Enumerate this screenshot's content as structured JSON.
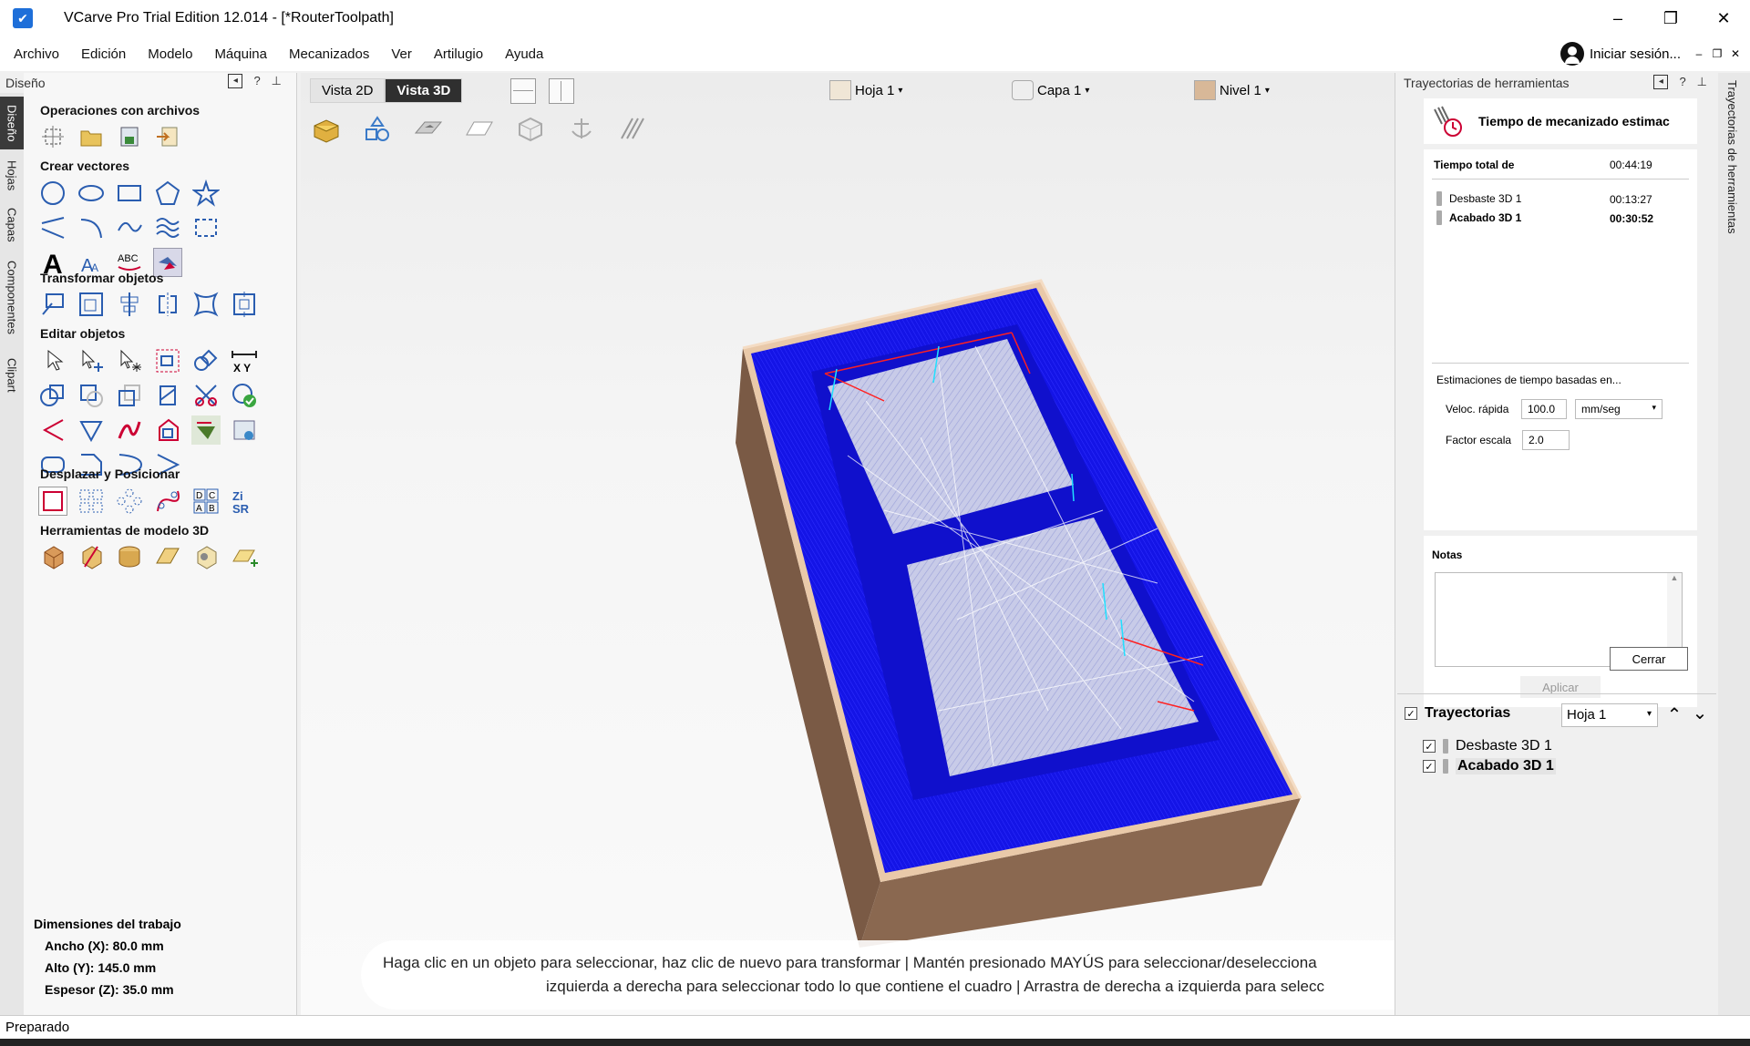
{
  "window": {
    "title": "VCarve Pro Trial Edition 12.014 - [*RouterToolpath]",
    "minimize": "–",
    "restore": "❐",
    "close": "✕"
  },
  "menu": [
    "Archivo",
    "Edición",
    "Modelo",
    "Máquina",
    "Mecanizados",
    "Ver",
    "Artilugio",
    "Ayuda"
  ],
  "signin": {
    "label": "Iniciar sesión...",
    "min": "–",
    "restore": "❐",
    "close": "✕"
  },
  "left_tabs": [
    "Diseño",
    "Hojas",
    "Capas",
    "Componentes",
    "Clipart"
  ],
  "left_panel": {
    "title": "Diseño",
    "help": "?",
    "pin": "⊥",
    "sections": [
      "Operaciones con archivos",
      "Crear vectores",
      "Transformar objetos",
      "Editar objetos",
      "Desplazar y Posicionar",
      "Herramientas de modelo 3D"
    ],
    "dims": {
      "title": "Dimensiones del trabajo",
      "width": "Ancho  (X): 80.0 mm",
      "height": "Alto    (Y): 145.0 mm",
      "thickness": "Espesor (Z): 35.0 mm"
    }
  },
  "viewport": {
    "tabs": [
      "Vista 2D",
      "Vista 3D"
    ],
    "active_tab": "Vista 3D",
    "sheet": "Hoja 1",
    "layer": "Capa 1",
    "level": "Nivel 1",
    "hint_line1": "Haga clic en un objeto para seleccionar, haz clic de nuevo para transformar | Mantén presionado MAYÚS para seleccionar/deselecciona",
    "hint_line2": "izquierda a derecha para seleccionar todo lo que contiene el cuadro | Arrastra de derecha a izquierda para selecc"
  },
  "right_panel": {
    "title": "Trayectorias de herramientas",
    "help": "?",
    "pin": "⊥",
    "estimate_title": "Tiempo de mecanizado estimac",
    "total_label": "Tiempo total de",
    "total_value": "00:44:19",
    "rows": [
      {
        "name": "Desbaste 3D 1",
        "time": "00:13:27"
      },
      {
        "name": "Acabado 3D 1",
        "time": "00:30:52"
      }
    ],
    "based_on": "Estimaciones de tiempo basadas en...",
    "rapid_label": "Veloc. rápida",
    "rapid_value": "100.0",
    "unit": "mm/seg",
    "scale_label": "Factor escala",
    "scale_value": "2.0",
    "notes_label": "Notas",
    "apply": "Aplicar",
    "close": "Cerrar",
    "toolpaths_label": "Trayectorias",
    "sheet_select": "Hoja 1",
    "toolpaths": [
      "Desbaste 3D 1",
      "Acabado 3D 1"
    ]
  },
  "right_vtab": "Trayectorias de herramientas",
  "status": "Preparado",
  "colors": {
    "pocket_blue": "#1414e6",
    "wood": "#b88c6a",
    "accent": "#1e6fd9"
  }
}
